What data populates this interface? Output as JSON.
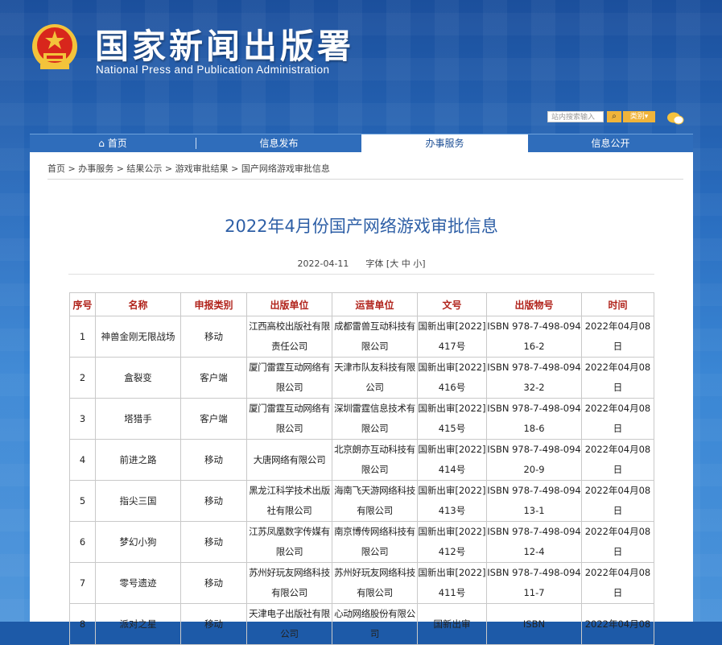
{
  "header": {
    "title_cn": "国家新闻出版署",
    "title_en": "National Press and Publication Administration",
    "search_placeholder": "站内搜索输入",
    "category_label": "类别▾"
  },
  "nav": {
    "home": "首页",
    "items": [
      "信息发布",
      "办事服务",
      "信息公开"
    ]
  },
  "breadcrumb": "首页 > 办事服务 > 结果公示 > 游戏审批结果 > 国产网络游戏审批信息",
  "article": {
    "title": "2022年4月份国产网络游戏审批信息",
    "date": "2022-04-11",
    "font_label": "字体 [大 中 小]"
  },
  "table": {
    "headers": [
      "序号",
      "名称",
      "申报类别",
      "出版单位",
      "运营单位",
      "文号",
      "出版物号",
      "时间"
    ],
    "rows": [
      [
        "1",
        "神兽金刚无限战场",
        "移动",
        "江西高校出版社有限责任公司",
        "成都雷兽互动科技有限公司",
        "国新出审[2022]417号",
        "ISBN 978-7-498-09416-2",
        "2022年04月08日"
      ],
      [
        "2",
        "盒裂变",
        "客户端",
        "厦门雷霆互动网络有限公司",
        "天津市队友科技有限公司",
        "国新出审[2022]416号",
        "ISBN 978-7-498-09432-2",
        "2022年04月08日"
      ],
      [
        "3",
        "塔猎手",
        "客户端",
        "厦门雷霆互动网络有限公司",
        "深圳雷霆信息技术有限公司",
        "国新出审[2022]415号",
        "ISBN 978-7-498-09418-6",
        "2022年04月08日"
      ],
      [
        "4",
        "前进之路",
        "移动",
        "大唐网络有限公司",
        "北京朗亦互动科技有限公司",
        "国新出审[2022]414号",
        "ISBN 978-7-498-09420-9",
        "2022年04月08日"
      ],
      [
        "5",
        "指尖三国",
        "移动",
        "黑龙江科学技术出版社有限公司",
        "海南飞天游网络科技有限公司",
        "国新出审[2022]413号",
        "ISBN 978-7-498-09413-1",
        "2022年04月08日"
      ],
      [
        "6",
        "梦幻小狗",
        "移动",
        "江苏凤凰数字传媒有限公司",
        "南京博传网络科技有限公司",
        "国新出审[2022]412号",
        "ISBN 978-7-498-09412-4",
        "2022年04月08日"
      ],
      [
        "7",
        "零号遗迹",
        "移动",
        "苏州好玩友网络科技有限公司",
        "苏州好玩友网络科技有限公司",
        "国新出审[2022]411号",
        "ISBN 978-7-498-09411-7",
        "2022年04月08日"
      ],
      [
        "8",
        "派对之星",
        "移动",
        "天津电子出版社有限公司",
        "心动网络股份有限公司",
        "国新出审",
        "ISBN",
        "2022年04月08"
      ]
    ]
  },
  "colors": {
    "header_bg": "#1b4f9c",
    "nav_bg": "#2f6dbb",
    "title_blue": "#2e5fa6",
    "table_header_red": "#b1241c"
  }
}
